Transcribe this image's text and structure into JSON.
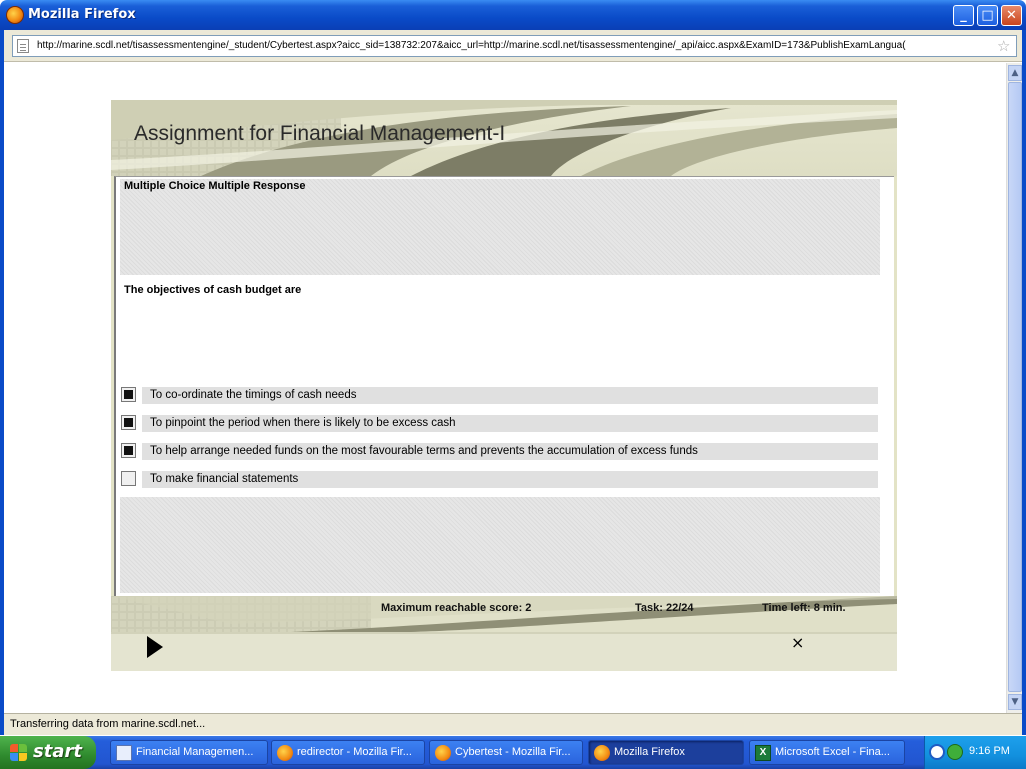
{
  "window": {
    "title": "Mozilla Firefox",
    "url": "http://marine.scdl.net/tisassessmentengine/_student/Cybertest.aspx?aicc_sid=138732:207&aicc_url=http://marine.scdl.net/tisassessmentengine/_api/aicc.aspx&ExamID=173&PublishExamLangua(",
    "status": "Transferring data from marine.scdl.net..."
  },
  "exam": {
    "title": "Assignment for Financial Management-I",
    "question_type": "Multiple Choice Multiple Response",
    "question": "The objectives of cash budget are",
    "options": [
      {
        "label": "To co-ordinate the timings of cash needs",
        "checked": true
      },
      {
        "label": "To pinpoint the period when there is likely to be excess cash",
        "checked": true
      },
      {
        "label": "To help arrange needed funds on the most favourable terms and prevents the accumulation of excess funds",
        "checked": true
      },
      {
        "label": "To make financial statements",
        "checked": false
      }
    ],
    "max_score": "Maximum reachable score: 2",
    "task": "Task: 22/24",
    "time_left": "Time left: 8 min.",
    "close_symbol": "×"
  },
  "taskbar": {
    "start_label": "start",
    "items": [
      {
        "label": "Financial Managemen...",
        "icon": "document-icon"
      },
      {
        "label": "redirector - Mozilla Fir...",
        "icon": "firefox-icon"
      },
      {
        "label": "Cybertest - Mozilla Fir...",
        "icon": "firefox-icon"
      },
      {
        "label": "Mozilla Firefox",
        "icon": "firefox-icon",
        "active": true
      },
      {
        "label": "Microsoft Excel - Fina...",
        "icon": "excel-icon"
      }
    ],
    "clock": "9:16 PM"
  },
  "colors": {
    "xp_blue": "#0a4bc8",
    "exam_bg": "#e3e3c6",
    "option_bar": "#e0e0e0"
  }
}
